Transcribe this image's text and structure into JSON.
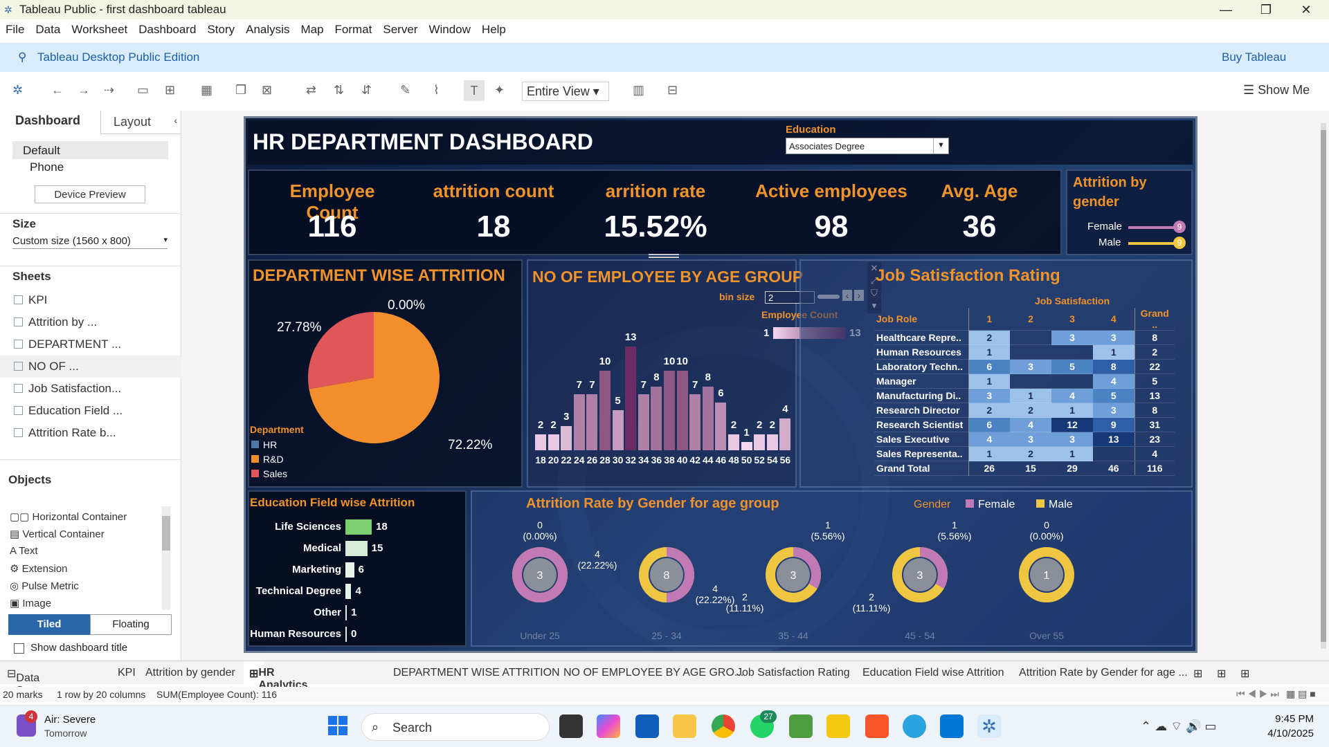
{
  "window": {
    "title": "Tableau Public - first dashboard tableau"
  },
  "menu": [
    "File",
    "Data",
    "Worksheet",
    "Dashboard",
    "Story",
    "Analysis",
    "Map",
    "Format",
    "Server",
    "Window",
    "Help"
  ],
  "banner": {
    "edition": "Tableau Desktop Public Edition",
    "buy": "Buy Tableau"
  },
  "toolbar": {
    "view": "Entire View",
    "show_me": "Show Me"
  },
  "sidebar": {
    "tab_dashboard": "Dashboard",
    "tab_layout": "Layout",
    "device_default": "Default",
    "device_phone": "Phone",
    "device_preview": "Device Preview",
    "size_heading": "Size",
    "size_value": "Custom size (1560 x 800)",
    "sheets_heading": "Sheets",
    "sheets": [
      "KPI",
      "Attrition by ...",
      "DEPARTMENT ...",
      "NO OF ...",
      "Job Satisfaction...",
      "Education Field ...",
      "Attrition Rate b..."
    ],
    "objects_heading": "Objects",
    "objects": [
      "Horizontal Container",
      "Vertical Container",
      "Text",
      "Extension",
      "Pulse Metric",
      "Image"
    ],
    "tiled": "Tiled",
    "floating": "Floating",
    "show_title": "Show dashboard title"
  },
  "dashboard": {
    "title": "HR DEPARTMENT DASHBOARD",
    "filter": {
      "label": "Education",
      "value": "Associates Degree"
    },
    "kpis": [
      {
        "label": "Employee Count",
        "value": "116"
      },
      {
        "label": "attrition count",
        "value": "18"
      },
      {
        "label": "arrition rate",
        "value": "15.52%"
      },
      {
        "label": "Active employees",
        "value": "98"
      },
      {
        "label": "Avg. Age",
        "value": "36"
      }
    ],
    "gender": {
      "title1": "Attrition by",
      "title2": "gender",
      "female_label": "Female",
      "female_value": "9",
      "male_label": "Male",
      "male_value": "9"
    },
    "dept": {
      "title": "DEPARTMENT WISE ATTRITION",
      "legend_title": "Department",
      "legend": [
        "HR",
        "R&D",
        "Sales"
      ],
      "labels": [
        "0.00%",
        "27.78%",
        "72.22%"
      ]
    },
    "age": {
      "title": "NO OF EMPLOYEE BY AGE GROUP",
      "bin_label": "bin size",
      "bin_value": "2",
      "legend_title": "Employee Count",
      "legend_min": "1",
      "legend_max": "13"
    },
    "job": {
      "title": "Job Satisfaction Rating",
      "col_header": "Job Satisfaction",
      "role_header": "Job Role",
      "cols": [
        "1",
        "2",
        "3",
        "4",
        "Grand .."
      ],
      "rows": [
        {
          "role": "Healthcare Repre..",
          "c": [
            "2",
            "",
            "3",
            "3",
            "8"
          ]
        },
        {
          "role": "Human Resources",
          "c": [
            "1",
            "",
            "",
            "1",
            "2"
          ]
        },
        {
          "role": "Laboratory Techn..",
          "c": [
            "6",
            "3",
            "5",
            "8",
            "22"
          ]
        },
        {
          "role": "Manager",
          "c": [
            "1",
            "",
            "",
            "4",
            "5"
          ]
        },
        {
          "role": "Manufacturing Di..",
          "c": [
            "3",
            "1",
            "4",
            "5",
            "13"
          ]
        },
        {
          "role": "Research Director",
          "c": [
            "2",
            "2",
            "1",
            "3",
            "8"
          ]
        },
        {
          "role": "Research Scientist",
          "c": [
            "6",
            "4",
            "12",
            "9",
            "31"
          ]
        },
        {
          "role": "Sales Executive",
          "c": [
            "4",
            "3",
            "3",
            "13",
            "23"
          ]
        },
        {
          "role": "Sales Representa..",
          "c": [
            "1",
            "2",
            "1",
            "",
            "4"
          ]
        }
      ],
      "total": {
        "role": "Grand Total",
        "c": [
          "26",
          "15",
          "29",
          "46",
          "116"
        ]
      }
    },
    "edu": {
      "title": "Education Field wise Attrition"
    },
    "gage": {
      "title": "Attrition Rate by Gender for age group",
      "legend_title": "Gender",
      "legend_female": "Female",
      "legend_male": "Male",
      "groups": [
        {
          "center": "3",
          "x": "Under 25",
          "a": "0",
          "a2": "(0.00%)"
        },
        {
          "center": "8",
          "x": "25 - 34",
          "a": "4",
          "a2": "(22.22%)",
          "b": "4",
          "b2": "(22.22%)"
        },
        {
          "center": "3",
          "x": "35 - 44",
          "a": "1",
          "a2": "(5.56%)",
          "b": "2",
          "b2": "(11.11%)"
        },
        {
          "center": "3",
          "x": "45 - 54",
          "a": "1",
          "a2": "(5.56%)",
          "b": "2",
          "b2": "(11.11%)"
        },
        {
          "center": "1",
          "x": "Over 55",
          "a": "0",
          "a2": "(0.00%)"
        }
      ]
    }
  },
  "chart_data": [
    {
      "type": "pie",
      "title": "DEPARTMENT WISE ATTRITION",
      "categories": [
        "HR",
        "R&D",
        "Sales"
      ],
      "values": [
        0.0,
        72.22,
        27.78
      ],
      "colors": [
        "#4e79a7",
        "#f28e2b",
        "#e15759"
      ]
    },
    {
      "type": "bar",
      "title": "NO OF EMPLOYEE BY AGE GROUP",
      "categories": [
        "18",
        "20",
        "22",
        "24",
        "26",
        "28",
        "30",
        "32",
        "34",
        "36",
        "38",
        "40",
        "42",
        "44",
        "46",
        "48",
        "50",
        "52",
        "54",
        "56"
      ],
      "values": [
        2,
        2,
        3,
        7,
        7,
        10,
        5,
        13,
        7,
        8,
        10,
        10,
        7,
        8,
        6,
        2,
        1,
        2,
        2,
        4
      ]
    },
    {
      "type": "bar",
      "title": "Education Field wise Attrition",
      "categories": [
        "Life Sciences",
        "Medical",
        "Marketing",
        "Technical Degree",
        "Other",
        "Human Resources"
      ],
      "values": [
        18,
        15,
        6,
        4,
        1,
        0
      ]
    }
  ],
  "tabs": [
    "Data Source",
    "KPI",
    "Attrition by gender",
    "HR Analytics Dashboard",
    "DEPARTMENT WISE ATTRITION",
    "NO OF EMPLOYEE BY AGE GRO...",
    "Job Satisfaction Rating",
    "Education Field wise Attrition",
    "Attrition Rate by Gender for age ..."
  ],
  "status": {
    "marks": "20 marks",
    "dims": "1 row by 20 columns",
    "sum": "SUM(Employee Count): 116"
  },
  "taskbar": {
    "weather1": "Air: Severe",
    "weather2": "Tomorrow",
    "badge": "4",
    "search": "Search",
    "whatsapp": "27",
    "time": "9:45 PM",
    "date": "4/10/2025"
  }
}
